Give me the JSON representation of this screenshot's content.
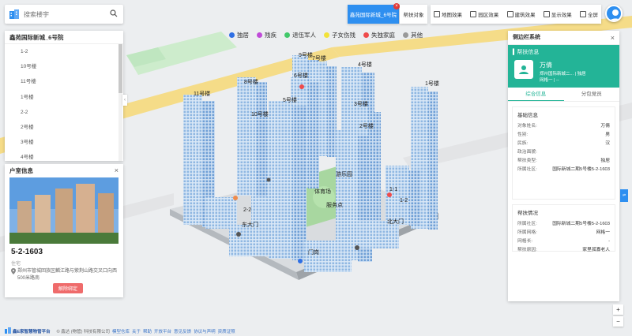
{
  "search": {
    "placeholder": "搜索楼宇"
  },
  "building_panel": {
    "title": "鑫苑国际新城_6号院",
    "items": [
      "1-2",
      "10号楼",
      "11号楼",
      "1号楼",
      "2-2",
      "2号楼",
      "3号楼",
      "4号楼"
    ]
  },
  "household_panel": {
    "title": "户室信息",
    "unit": "5-2-1603",
    "type": "住宅",
    "address": "郑州市管城回族区麟江路与紫荆山路交叉口向西500米路南",
    "unbind_label": "解除绑定"
  },
  "legend": [
    {
      "label": "独居",
      "color": "#2f6fe4"
    },
    {
      "label": "残疾",
      "color": "#c04bd8"
    },
    {
      "label": "退伍军人",
      "color": "#42c86a"
    },
    {
      "label": "子女伤残",
      "color": "#f2e23a"
    },
    {
      "label": "失独家庭",
      "color": "#ef4b4b"
    },
    {
      "label": "其他",
      "color": "#999999"
    }
  ],
  "toolbar": {
    "active_label": "鑫苑国际新城_6号院",
    "badge": "×",
    "help_label": "帮扶对象",
    "items": [
      "地图效果",
      "园区效果",
      "建筑效果",
      "显示效果",
      "全屏"
    ]
  },
  "side_panel": {
    "title": "侧边栏系统",
    "help_label": "帮扶信息",
    "name": "万倩",
    "sub1": "郑州国际新城二...  |  独居",
    "sub2": "网格一  |  --",
    "tabs": [
      "综合信息",
      "分包党员"
    ],
    "basic_title": "基础信息",
    "basic": [
      {
        "k": "对象姓名:",
        "v": "万倩"
      },
      {
        "k": "性别:",
        "v": "男"
      },
      {
        "k": "民族:",
        "v": "汉"
      },
      {
        "k": "政治面貌:",
        "v": ""
      },
      {
        "k": "帮扶类型:",
        "v": "独居"
      },
      {
        "k": "所属社区:",
        "v": "国际新城二期5号楼5-2-1603"
      }
    ],
    "help_title": "帮扶情况",
    "help": [
      {
        "k": "所属社区:",
        "v": "国际新城二期5号楼5-2-1603"
      },
      {
        "k": "所属网格:",
        "v": "网格一"
      },
      {
        "k": "网格长:",
        "v": "-"
      },
      {
        "k": "帮扶原因:",
        "v": "家里孤寡老人"
      }
    ]
  },
  "map_labels": [
    "9号楼",
    "7号楼",
    "4号楼",
    "8号楼",
    "6号楼",
    "1号楼",
    "11号楼",
    "5号楼",
    "3号楼",
    "10号楼",
    "2号楼",
    "2-2",
    "1-1",
    "1-2",
    "东大门",
    "北大门",
    "门岗",
    "体育场",
    "游乐园",
    "服务点"
  ],
  "right_controls": {
    "zoom_in": "+",
    "zoom_out": "−",
    "blue_tab": "⇌"
  },
  "footer": {
    "brand": "鑫E家智慧物管平台",
    "copyright": "© 鑫达 (物管) 科技有限公司",
    "links": [
      "模型仓库",
      "关于",
      "帮助",
      "开放平台",
      "意见反馈",
      "协议与声明",
      "资质证照"
    ]
  }
}
